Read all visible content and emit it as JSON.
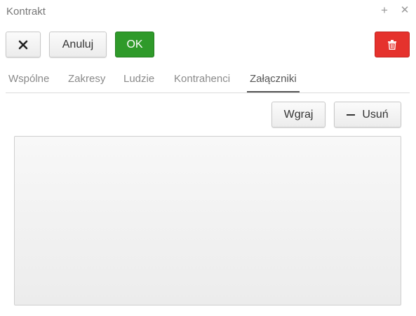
{
  "window": {
    "title": "Kontrakt",
    "add_icon": "plus-icon",
    "close_icon": "close-icon"
  },
  "toolbar": {
    "close_icon": "x-icon",
    "cancel_label": "Anuluj",
    "ok_label": "OK",
    "delete_icon": "trash-icon",
    "ok_color": "#2f9a2a",
    "delete_color": "#e5322d"
  },
  "tabs": [
    {
      "label": "Wspólne"
    },
    {
      "label": "Zakresy"
    },
    {
      "label": "Ludzie"
    },
    {
      "label": "Kontrahenci"
    },
    {
      "label": "Załączniki",
      "active": true
    }
  ],
  "attachments": {
    "upload_label": "Wgraj",
    "remove_label": "Usuń",
    "remove_icon": "minus-icon",
    "files": []
  }
}
